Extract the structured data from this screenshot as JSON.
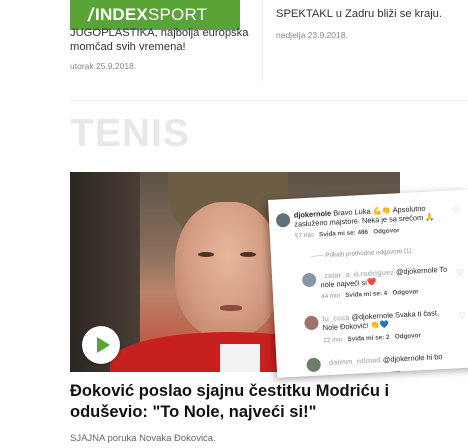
{
  "top_left": {
    "logo_part1": "INDEX",
    "logo_part2": "SPORT",
    "teaser": "JUGOPLASTIKA, najbolja europska momčad svih vremena!",
    "date": "utorak 25.9.2018."
  },
  "top_right": {
    "teaser": "SPEKTAKL u Zadru bliži se kraju.",
    "date": "nedjelja 23.9.2018."
  },
  "section": {
    "title": "TENIS"
  },
  "comments": {
    "c1_user": "djokernole",
    "c1_text": "Bravo Luka 💪👏 Apsolutno zasluženo majstore. Neka je sa srećom 🙏",
    "c1_time": "57 min",
    "c1_likes": "Sviđa mi se: 486",
    "c1_reply": "Odgovor",
    "hidden_replies": "Prikaži prethodne odgovore (1)",
    "c2_user": "_zatar_a_d.rodriguez",
    "c2_text": "@djokernole To nole najveći si❤️",
    "c2_time": "44 min",
    "c2_likes": "Sviđa mi se: 4",
    "c2_reply": "Odgovor",
    "c3_user": "lu_ccca",
    "c3_text": "@djokernole Svaka ti čast, Nole Đoković! 👏💙",
    "c3_time": "22 min",
    "c3_likes": "Sviđa mi se: 2",
    "c3_reply": "Odgovor",
    "c4_user": "_dalmm_ntlmad",
    "c4_text": "@djokernole hi bo"
  },
  "article": {
    "headline": "Đoković poslao sjajnu čestitku Modriću i oduševio: \"To Nole, najveći si!\"",
    "subline": "SJAJNA poruka Novaka Đokovića."
  },
  "colors": {
    "brand_green": "#5aa336",
    "shirt_red": "#c8201e",
    "section_title": "#e8e8e8"
  }
}
